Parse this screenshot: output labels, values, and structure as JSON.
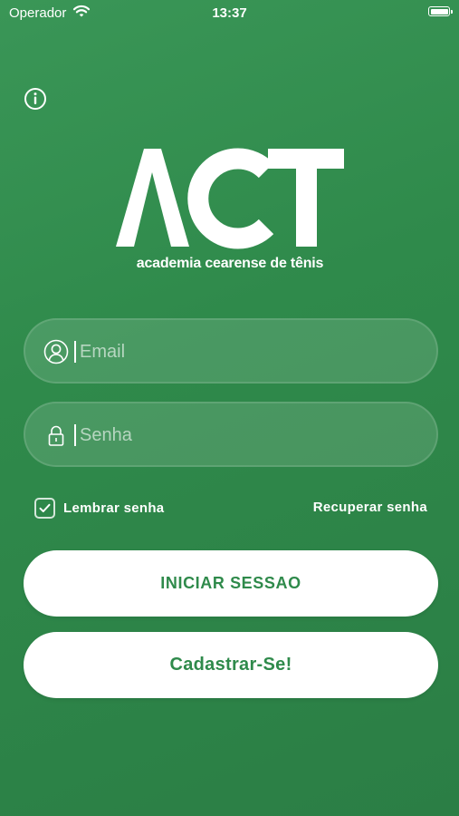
{
  "status_bar": {
    "carrier": "Operador",
    "time": "13:37",
    "icons": [
      "wifi-icon",
      "battery-icon"
    ]
  },
  "header": {
    "info_icon": "info-icon"
  },
  "logo": {
    "wordmark": "ACT",
    "tagline": "academia cearense de tênis"
  },
  "form": {
    "email": {
      "placeholder": "Email",
      "value": "",
      "icon": "user-icon"
    },
    "password": {
      "placeholder": "Senha",
      "value": "",
      "icon": "lock-icon"
    },
    "remember": {
      "label": "Lembrar senha",
      "checked": true
    },
    "recover_label": "Recuperar senha"
  },
  "buttons": {
    "login": "INICIAR SESSAO",
    "signup": "Cadastrar-Se!"
  },
  "colors": {
    "background": "#2f8a4b",
    "accent_text": "#2f8a4b",
    "button_bg": "#ffffff"
  }
}
